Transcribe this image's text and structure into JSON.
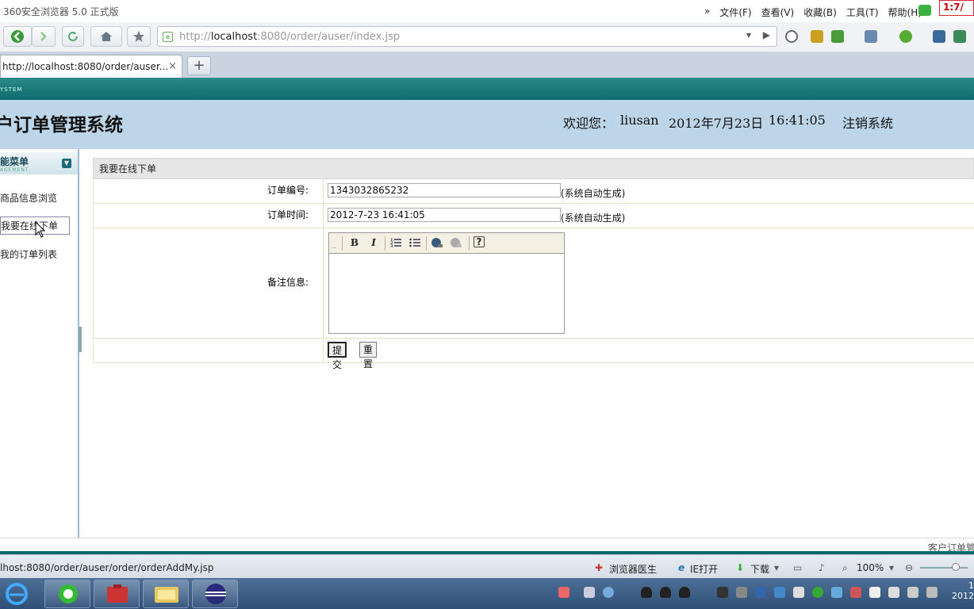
{
  "browser": {
    "window_title": "360安全浏览器 5.0 正式版",
    "menus": [
      "文件(F)",
      "查看(V)",
      "收藏(B)",
      "工具(T)",
      "帮助(H)"
    ],
    "menu_chevron": "»",
    "clock_badge": "1:7/",
    "address_prefix": "http://",
    "address_host": "localhost",
    "address_rest": ":8080/order/auser/index.jsp",
    "tab_title": "http://localhost:8080/order/auser...",
    "tab_close": "×",
    "new_tab": "+"
  },
  "header": {
    "system_label": "YSTEM",
    "title": "户订单管理系统",
    "welcome": "欢迎您：",
    "user": "liusan",
    "date": "2012年7月23日",
    "time": "16:41:05",
    "logout": "注销系统"
  },
  "sidebar": {
    "title": "能菜单",
    "subtitle": "AGEMENT",
    "items": [
      {
        "label": "商品信息浏览"
      },
      {
        "label": "我要在线下单"
      },
      {
        "label": "我的订单列表"
      }
    ]
  },
  "form": {
    "title": "我要在线下单",
    "order_no_label": "订单编号:",
    "order_no_value": "1343032865232",
    "order_no_hint": "(系统自动生成)",
    "order_time_label": "订单时间:",
    "order_time_value": "2012-7-23 16:41:05",
    "order_time_hint": "(系统自动生成)",
    "remark_label": "备注信息:",
    "editor_tools": {
      "bold": "B",
      "italic": "I",
      "help": "?"
    },
    "submit": "提交",
    "reset": "重置"
  },
  "footer": {
    "text": "客户订单管"
  },
  "statusbar": {
    "url": "lhost:8080/order/auser/order/orderAddMy.jsp",
    "doctor": "浏览器医生",
    "ie_open": "IE打开",
    "download": "下载",
    "zoom": "100%"
  },
  "taskbar": {
    "clock_top": "1",
    "clock_bottom": "2012"
  },
  "colors": {
    "teal_stripe": "#0d6b6b",
    "header_bg": "#bcd5e8",
    "taskbar": "#2f4f77"
  }
}
